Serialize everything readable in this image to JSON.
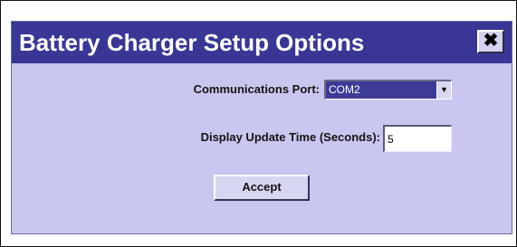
{
  "dialog": {
    "title": "Battery Charger Setup Options",
    "close_glyph": "✖"
  },
  "form": {
    "comm_port": {
      "label": "Communications Port:",
      "selected": "COM2",
      "arrow_glyph": "▼"
    },
    "update_time": {
      "label": "Display Update Time (Seconds):",
      "value": "5"
    },
    "accept_label": "Accept"
  },
  "colors": {
    "titlebar": "#3a3696",
    "dialog_body": "#c9c7ef",
    "select_highlight": "#3e3a98"
  },
  "icons": {
    "close": "close-icon",
    "dropdown": "chevron-down-icon"
  }
}
